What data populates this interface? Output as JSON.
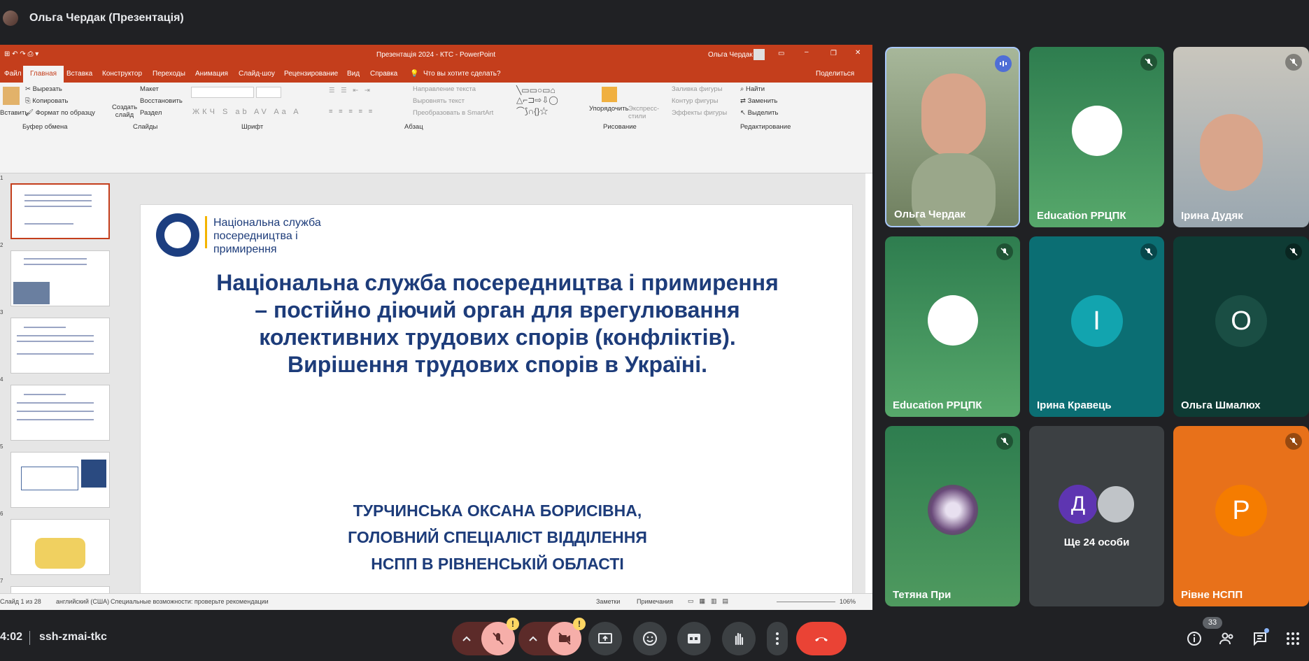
{
  "top": {
    "presenter_title": "Ольга Чердак (Презентація)"
  },
  "ppt": {
    "window_title": "Презентація 2024 - КТС  -  PowerPoint",
    "user": "Ольга Чердак",
    "share": "Поделиться",
    "tellme": "Что вы хотите сделать?",
    "tabs": [
      "Файл",
      "Главная",
      "Вставка",
      "Конструктор",
      "Переходы",
      "Анимация",
      "Слайд-шоу",
      "Рецензирование",
      "Вид",
      "Справка"
    ],
    "ribbon": {
      "cut": "Вырезать",
      "copy": "Копировать",
      "format_painter": "Формат по образцу",
      "paste": "Вставить",
      "create_slide": "Создать слайд",
      "layout": "Макет",
      "reset": "Восстановить",
      "section": "Раздел",
      "text_dir": "Направление текста",
      "align_text": "Выровнять текст",
      "smartart": "Преобразовать в SmartArt",
      "arrange": "Упорядочить",
      "express": "Экспресс-стили",
      "fill": "Заливка фигуры",
      "outline": "Контур фигуры",
      "effects": "Эффекты фигуры",
      "find": "Найти",
      "replace": "Заменить",
      "select": "Выделить",
      "groups": [
        "Буфер обмена",
        "Слайды",
        "Шрифт",
        "Абзац",
        "Рисование",
        "Редактирование"
      ]
    },
    "thumb_numbers": [
      "1",
      "2",
      "3",
      "4",
      "5",
      "6",
      "7"
    ],
    "slide": {
      "logo_text": "Національна служба посередництва і примирення",
      "title": "Національна служба посередництва і примирення – постійно діючий орган для врегулювання колективних трудових спорів (конфліктів). Вирішення трудових спорів в Україні.",
      "author_lines": [
        "ТУРЧИНСЬКА ОКСАНА БОРИСІВНА,",
        "ГОЛОВНИЙ СПЕЦІАЛІСТ ВІДДІЛЕННЯ",
        "НСПП В РІВНЕНСЬКІЙ ОБЛАСТІ"
      ]
    },
    "status": {
      "slide_of": "Слайд 1 из 28",
      "lang": "английский (США)",
      "access": "Специальные возможности: проверьте рекомендации",
      "notes": "Заметки",
      "comments": "Примечания",
      "zoom": "106%"
    }
  },
  "participants": [
    {
      "name": "Ольга Чердак",
      "kind": "video"
    },
    {
      "name": "Education РРЦПК",
      "kind": "logo"
    },
    {
      "name": "Ірина Дудяк",
      "kind": "video"
    },
    {
      "name": "Education РРЦПК",
      "kind": "logo"
    },
    {
      "name": "Ірина Кравець",
      "kind": "initial",
      "initial": "І",
      "color": "#12a4af"
    },
    {
      "name": "Ольга Шмалюх",
      "kind": "initial",
      "initial": "О",
      "color": "#1a4e44"
    },
    {
      "name": "Тетяна При",
      "kind": "photo"
    },
    {
      "name": "",
      "kind": "more",
      "more_text": "Ще 24 особи",
      "more_initial": "Д"
    },
    {
      "name": "Рівне НСПП",
      "kind": "initial",
      "initial": "Р",
      "color": "#f57c00"
    }
  ],
  "bottom": {
    "time": "4:02",
    "meeting_code": "ssh-zmai-tkc",
    "people_count": "33"
  },
  "colors": {
    "ppt_accent": "#c43e1c",
    "end_call": "#ea4335",
    "muted": "#f6aea9",
    "warn": "#fdd663"
  }
}
